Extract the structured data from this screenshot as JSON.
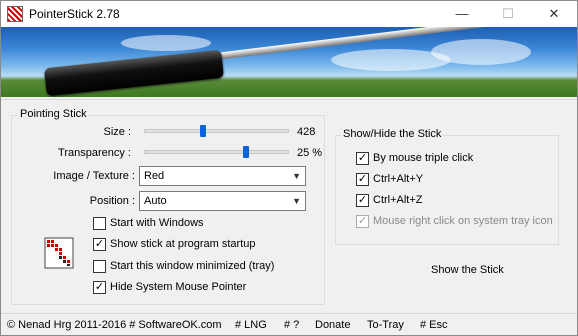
{
  "window": {
    "title": "PointerStick 2.78",
    "minimize": "—",
    "maximize": "☐",
    "close": "✕"
  },
  "pointing_stick": {
    "group_title": "Pointing Stick",
    "size_label": "Size :",
    "size_value": "428",
    "size_level": 0.41,
    "transparency_label": "Transparency :",
    "transparency_value": "25 %",
    "transparency_level": 0.7,
    "image_label": "Image / Texture :",
    "image_value": "Red",
    "position_label": "Position :",
    "position_value": "Auto",
    "options": [
      {
        "label": "Start with Windows",
        "checked": false
      },
      {
        "label": "Show stick at program startup",
        "checked": true
      },
      {
        "label": "Start this window minimized (tray)",
        "checked": false
      },
      {
        "label": "Hide System Mouse Pointer",
        "checked": true
      }
    ]
  },
  "show_hide": {
    "group_title": "Show/Hide the Stick",
    "options": [
      {
        "label": "By mouse triple click",
        "checked": true
      },
      {
        "label": "Ctrl+Alt+Y",
        "checked": true
      },
      {
        "label": "Ctrl+Alt+Z",
        "checked": true
      },
      {
        "label": "Mouse right click on system tray icon",
        "checked": true,
        "disabled": true
      }
    ],
    "show_button": "Show the Stick"
  },
  "statusbar": {
    "copyright": "© Nenad Hrg 2011-2016 # SoftwareOK.com",
    "lng": "# LNG",
    "help": "# ?",
    "donate": "Donate",
    "totray": "To-Tray",
    "esc": "# Esc"
  },
  "colors": {
    "accent": "#0a64d6",
    "window_bg": "#f0f0f0"
  }
}
